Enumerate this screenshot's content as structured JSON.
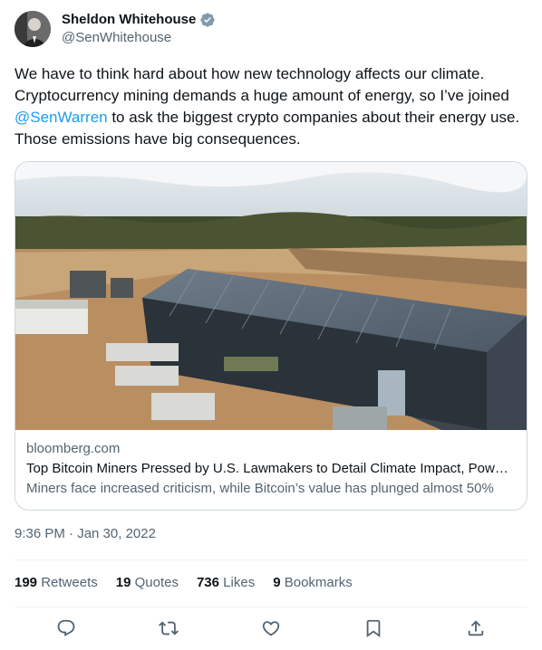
{
  "author": {
    "display_name": "Sheldon Whitehouse",
    "handle": "@SenWhitehouse",
    "verified": true
  },
  "tweet": {
    "text_before": "We have to think hard about how new technology affects our climate. Cryptocurrency mining demands a huge amount of energy, so I’ve joined ",
    "mention": "@SenWarren",
    "text_after": " to ask the biggest crypto companies about their energy use. Those emissions have big consequences."
  },
  "card": {
    "domain": "bloomberg.com",
    "title": "Top Bitcoin Miners Pressed by U.S. Lawmakers to Detail Climate Impact, Pow…",
    "description": "Miners face increased criticism, while Bitcoin’s value has plunged almost 50%"
  },
  "timestamp": "9:36 PM · Jan 30, 2022",
  "stats": {
    "retweets": {
      "count": "199",
      "label": "Retweets"
    },
    "quotes": {
      "count": "19",
      "label": "Quotes"
    },
    "likes": {
      "count": "736",
      "label": "Likes"
    },
    "bookmarks": {
      "count": "9",
      "label": "Bookmarks"
    }
  },
  "actions": [
    "reply-icon",
    "retweet-icon",
    "like-icon",
    "bookmark-icon",
    "share-icon"
  ],
  "colors": {
    "accent": "#1d9bf0",
    "text": "#0f1419",
    "secondary": "#536471",
    "border": "#cfd9de"
  }
}
